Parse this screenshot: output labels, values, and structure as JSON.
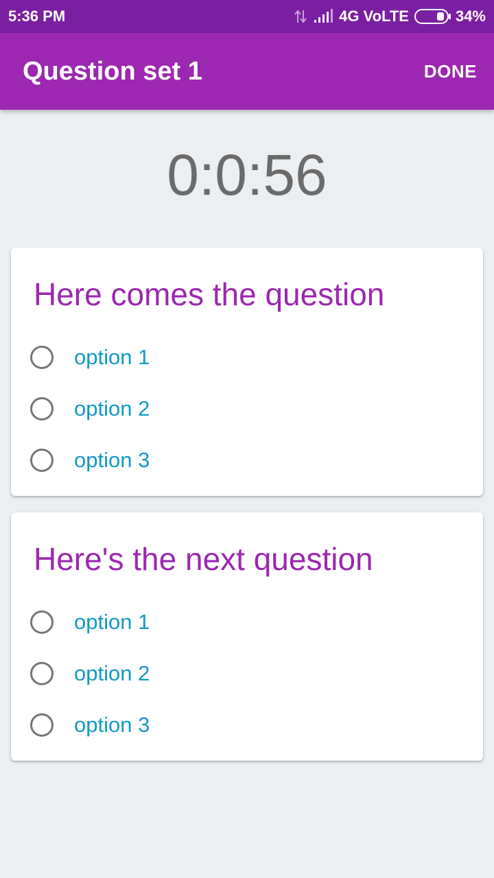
{
  "status_bar": {
    "time": "5:36 PM",
    "network": "4G VoLTE",
    "battery": "34%"
  },
  "app_bar": {
    "title": "Question set 1",
    "done_label": "DONE"
  },
  "timer": "0:0:56",
  "questions": [
    {
      "title": "Here comes the question",
      "options": [
        "option 1",
        "option 2",
        "option 3"
      ]
    },
    {
      "title": "Here's the next question",
      "options": [
        "option 1",
        "option 2",
        "option 3"
      ]
    }
  ],
  "colors": {
    "status_bar": "#7b1fa2",
    "app_bar": "#9c27b0",
    "question_text": "#9c27b0",
    "option_text": "#1199c7",
    "timer_text": "#6b6b6b",
    "background": "#eceff1"
  }
}
